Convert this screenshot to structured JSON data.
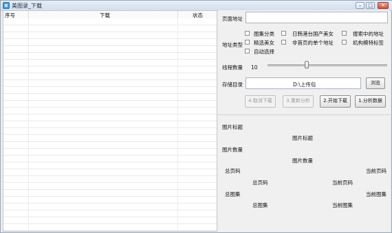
{
  "window": {
    "title": "美图录_下载",
    "minimize_glyph": "–",
    "restore_glyph": "□",
    "close_glyph": "✕"
  },
  "grid": {
    "columns": [
      "序号",
      "下载",
      "状态"
    ]
  },
  "form": {
    "page_url_label": "页面地址",
    "page_url_value": "",
    "address_type_label": "地址类型",
    "address_types": [
      "图集分类",
      "日韩港台国产美女",
      "搜索中的地址",
      "精选美女",
      "非首页的单个地址",
      "机构模特标签",
      "自动选择"
    ],
    "thread_count_label": "线程数量",
    "thread_count_value": "10",
    "thread_slider_fraction": 0.33,
    "save_dir_label": "存储目录",
    "save_dir_value": "D:\\上传包",
    "browse_button": "浏览",
    "buttons": {
      "cancel": "4.取消下载",
      "reanalyze": "3.重新分析",
      "start": "2.开始下载",
      "analyze": "1.分析数据"
    }
  },
  "info": {
    "image_title_label": "图片标题",
    "image_title_value": "图片标题",
    "image_count_label": "图片数量",
    "image_count_value": "图片数量",
    "total_pages_label": "总页码",
    "current_page_label": "当前页码",
    "total_pages_value": "总页码",
    "current_page_value": "当前页码",
    "total_albums_label": "总图集",
    "current_album_label": "当前图集",
    "total_albums_value": "总图集",
    "current_album_value": "当前图集"
  }
}
